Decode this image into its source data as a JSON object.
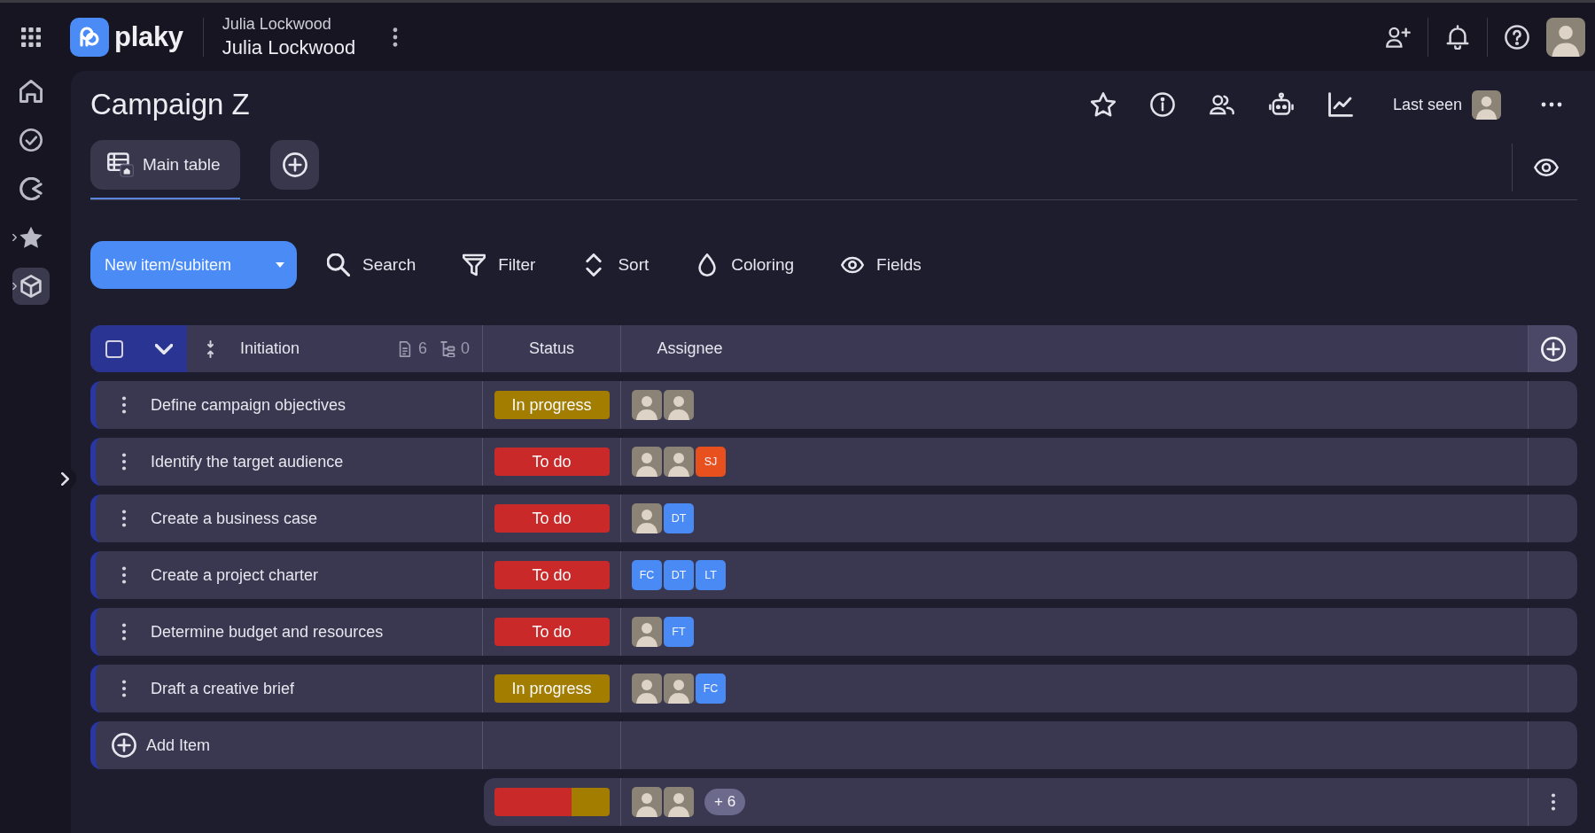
{
  "top_bar": {
    "logo_text": "plaky",
    "account": {
      "workspace": "Julia Lockwood",
      "name": "Julia Lockwood"
    }
  },
  "sidebar": {
    "items": [
      {
        "kind": "home",
        "selected": false,
        "has_submenu": false
      },
      {
        "kind": "tasks",
        "selected": false,
        "has_submenu": false
      },
      {
        "kind": "timer",
        "selected": false,
        "has_submenu": false
      },
      {
        "kind": "favorites",
        "selected": false,
        "has_submenu": true
      },
      {
        "kind": "workspaces",
        "selected": true,
        "has_submenu": true
      }
    ]
  },
  "board": {
    "title": "Campaign Z",
    "last_seen_label": "Last seen"
  },
  "views": [
    {
      "label": "Main table",
      "selected": true
    }
  ],
  "toolbar": {
    "new_button": "New item/subitem",
    "actions": [
      {
        "kind": "search",
        "label": "Search"
      },
      {
        "kind": "filter",
        "label": "Filter"
      },
      {
        "kind": "sort",
        "label": "Sort"
      },
      {
        "kind": "coloring",
        "label": "Coloring"
      },
      {
        "kind": "fields",
        "label": "Fields"
      }
    ]
  },
  "table": {
    "group": {
      "title": "Initiation",
      "checked": false,
      "expanded": true,
      "item_count": "6",
      "subitem_count": "0"
    },
    "columns": [
      "Status",
      "Assignee"
    ],
    "rows": [
      {
        "name": "Define campaign objectives",
        "status": {
          "label": "In progress",
          "color": "#a27d00"
        },
        "assignees": [
          {
            "kind": "photo"
          },
          {
            "kind": "photo"
          }
        ]
      },
      {
        "name": "Identify the target audience",
        "status": {
          "label": "To do",
          "color": "#c92929"
        },
        "assignees": [
          {
            "kind": "photo"
          },
          {
            "kind": "photo"
          },
          {
            "kind": "initials",
            "initials": "SJ",
            "color": "#e8501e"
          }
        ]
      },
      {
        "name": "Create a business case",
        "status": {
          "label": "To do",
          "color": "#c92929"
        },
        "assignees": [
          {
            "kind": "photo"
          },
          {
            "kind": "initials",
            "initials": "DT",
            "color": "#4a8af4"
          }
        ]
      },
      {
        "name": "Create a project charter",
        "status": {
          "label": "To do",
          "color": "#c92929"
        },
        "assignees": [
          {
            "kind": "initials",
            "initials": "FC",
            "color": "#4a8af4"
          },
          {
            "kind": "initials",
            "initials": "DT",
            "color": "#4a8af4"
          },
          {
            "kind": "initials",
            "initials": "LT",
            "color": "#4a8af4"
          }
        ]
      },
      {
        "name": "Determine budget and resources",
        "status": {
          "label": "To do",
          "color": "#c92929"
        },
        "assignees": [
          {
            "kind": "photo"
          },
          {
            "kind": "initials",
            "initials": "FT",
            "color": "#4a8af4"
          }
        ]
      },
      {
        "name": "Draft a creative brief",
        "status": {
          "label": "In progress",
          "color": "#a27d00"
        },
        "assignees": [
          {
            "kind": "photo"
          },
          {
            "kind": "photo"
          },
          {
            "kind": "initials",
            "initials": "FC",
            "color": "#4a8af4"
          }
        ]
      }
    ],
    "add_item_label": "Add Item",
    "summary": {
      "assignees": [
        {
          "kind": "photo"
        },
        {
          "kind": "photo"
        }
      ],
      "more_count": "+ 6"
    }
  }
}
